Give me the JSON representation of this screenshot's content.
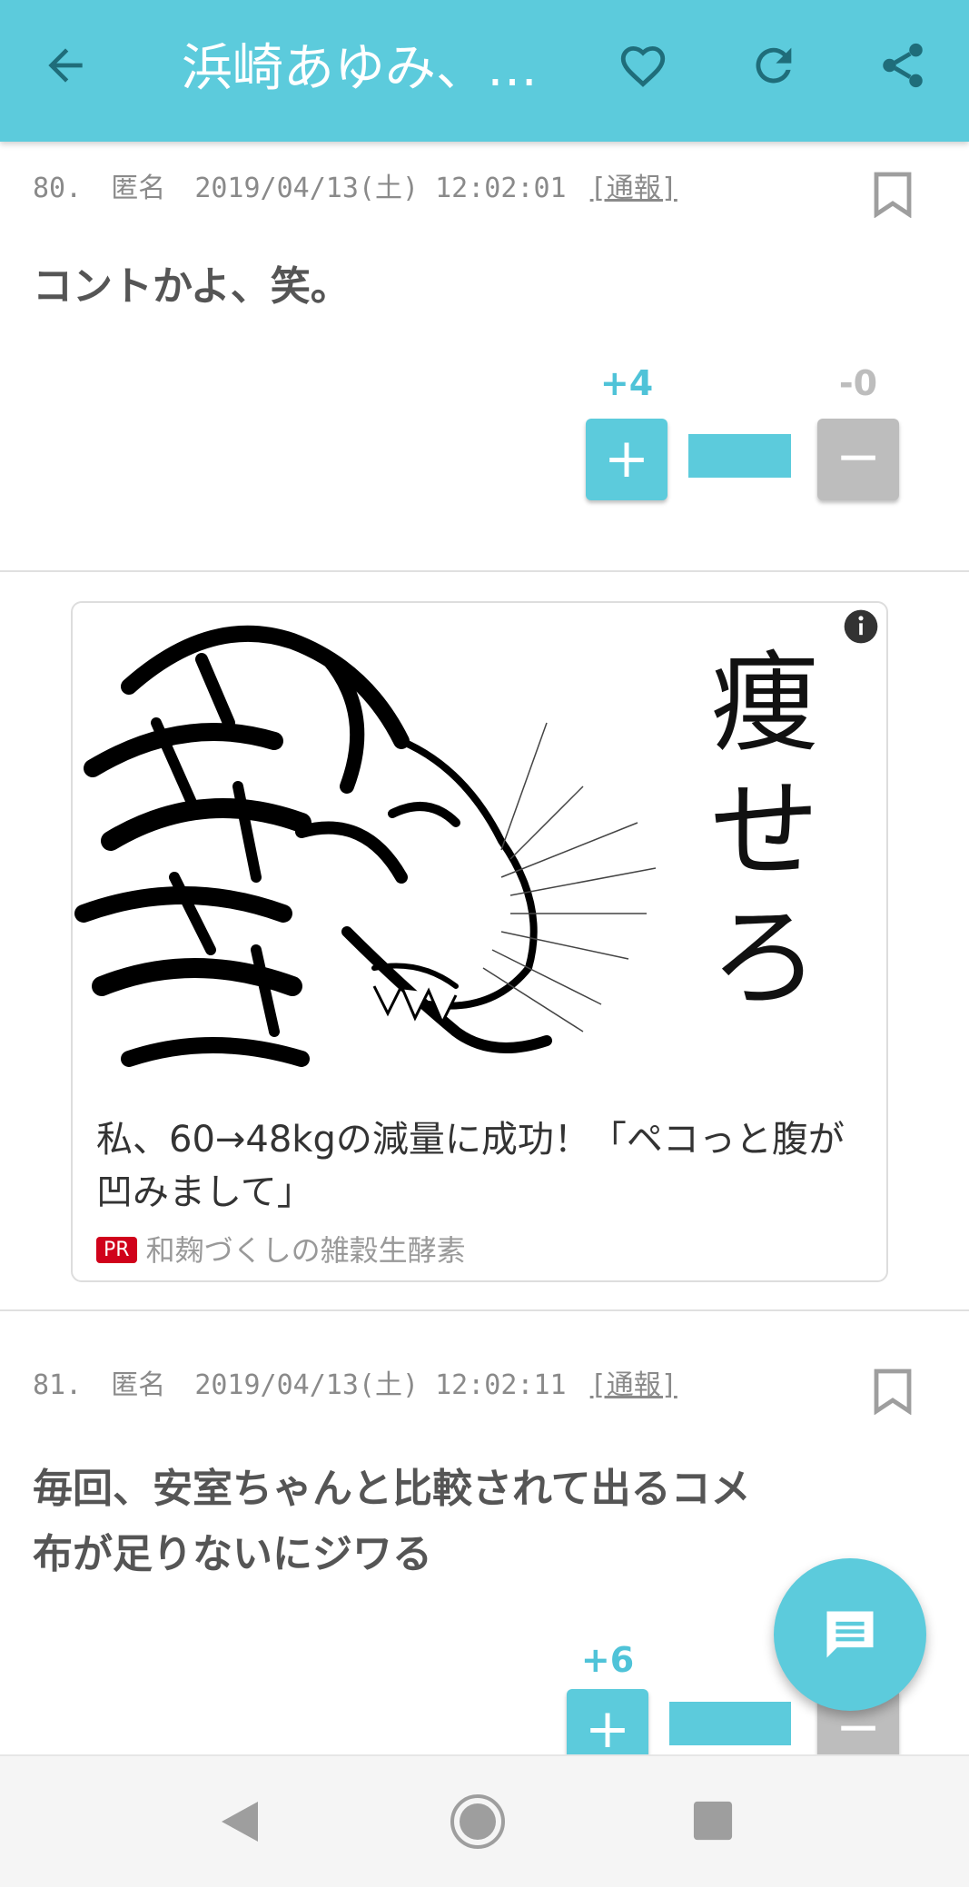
{
  "app_bar": {
    "title": "浜崎あゆみ、…",
    "back_icon": "arrow-left-icon",
    "favorite_icon": "heart-outline-icon",
    "refresh_icon": "refresh-icon",
    "share_icon": "share-icon"
  },
  "comments": [
    {
      "number": "80.",
      "author": "匿名",
      "datetime": "2019/04/13(土) 12:02:01",
      "report_label": "[通報]",
      "text": "コントかよ、笑。",
      "plus_count": "+4",
      "minus_count": "-0",
      "plus_label": "+",
      "minus_label": "−",
      "plus_ratio": 1.0
    },
    {
      "number": "81.",
      "author": "匿名",
      "datetime": "2019/04/13(土) 12:02:11",
      "report_label": "[通報]",
      "text_line1": "毎回、安室ちゃんと比較されて出るコメ",
      "text_line2": "布が足りないにジワる",
      "plus_count": "+6",
      "plus_label": "+",
      "minus_label": "−",
      "plus_ratio": 1.0
    }
  ],
  "ad": {
    "image_text": "痩せろ",
    "headline": "私、60→48kgの減量に成功！「ペコっと腹が凹みまして」",
    "pr_label": "PR",
    "source": "和麹づくしの雑穀生酵素",
    "info_icon": "info-icon"
  },
  "fab": {
    "icon": "chat-icon"
  },
  "nav_bar": {
    "back": "nav-back-icon",
    "home": "nav-home-icon",
    "recents": "nav-recents-icon"
  },
  "colors": {
    "accent": "#5ccbdc",
    "minus": "#bdbdbd",
    "text": "#555555",
    "meta": "#8a8a8a",
    "pr": "#d0021b"
  }
}
